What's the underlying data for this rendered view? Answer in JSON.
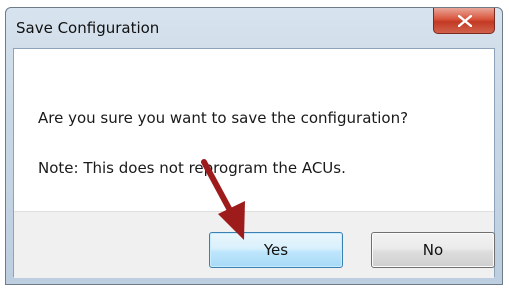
{
  "dialog": {
    "title": "Save Configuration",
    "close_icon": "close-x-icon",
    "message_line1": "Are you sure you want to save the configuration?",
    "message_line2": "Note: This does not reprogram the ACUs.",
    "yes_label": "Yes",
    "no_label": "No"
  },
  "annotation": {
    "icon": "red-pointer-arrow",
    "color": "#9e1b1b"
  },
  "colors": {
    "close_button": "#c33a24",
    "yes_button_border": "#3c7fb1",
    "titlebar": "#c9d8e6"
  }
}
